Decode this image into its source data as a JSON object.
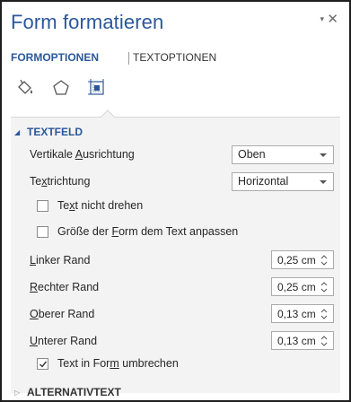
{
  "window": {
    "title": "Form formatieren",
    "controls": {
      "dropdown": "▾",
      "close": "✕"
    }
  },
  "tabs": [
    {
      "label": "FORMOPTIONEN",
      "active": true
    },
    {
      "label": "TEXTOPTIONEN",
      "active": false
    }
  ],
  "icons": [
    "fill-bucket-icon",
    "pentagon-shape-icon",
    "size-properties-icon"
  ],
  "accent_color": "#2b579a",
  "textfeld": {
    "header": "TEXTFELD",
    "vertical_alignment": {
      "label_pre": "Vertikale ",
      "label_ul": "A",
      "label_post": "usrichtung",
      "value": "Oben"
    },
    "text_direction": {
      "label_pre": "Te",
      "label_ul": "x",
      "label_post": "trichtung",
      "value": "Horizontal"
    },
    "no_rotate": {
      "label_pre": "Te",
      "label_ul": "x",
      "label_post": "t nicht drehen",
      "checked": false
    },
    "autofit": {
      "label_pre": "Größe der ",
      "label_ul": "F",
      "label_post": "orm dem Text anpassen",
      "checked": false
    },
    "margins": [
      {
        "label_ul": "L",
        "label_post": "inker Rand",
        "value": "0,25  cm"
      },
      {
        "label_ul": "R",
        "label_post": "echter Rand",
        "value": "0,25  cm"
      },
      {
        "label_ul": "O",
        "label_post": "berer Rand",
        "value": "0,13  cm"
      },
      {
        "label_ul": "U",
        "label_post": "nterer Rand",
        "value": "0,13  cm"
      }
    ],
    "wrap_text": {
      "label_pre": "Text in For",
      "label_ul": "m",
      "label_post": " umbrechen",
      "checked": true
    }
  },
  "alternativtext": {
    "header": "ALTERNATIVTEXT"
  }
}
